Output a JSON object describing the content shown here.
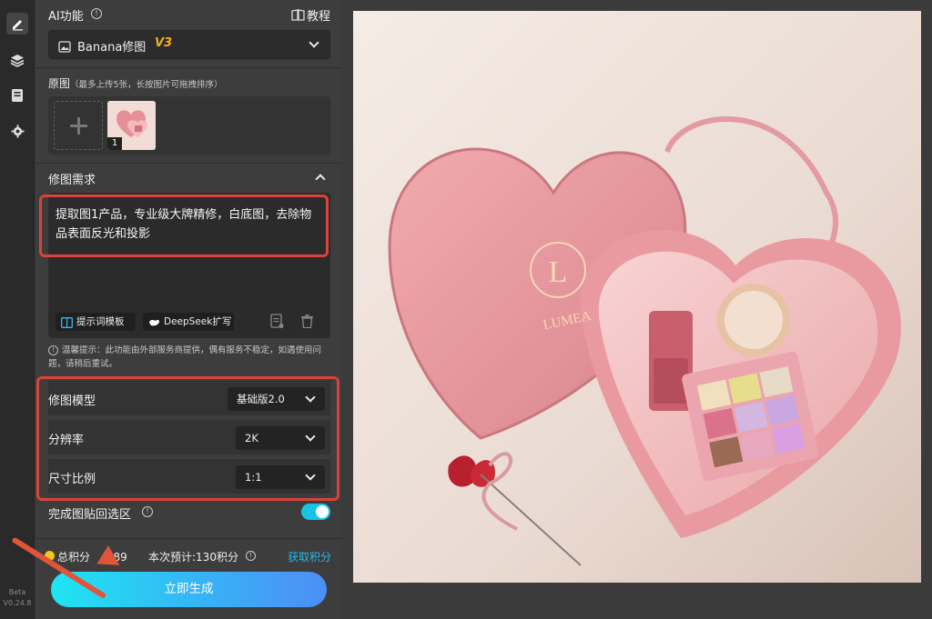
{
  "app": {
    "version_tag": "Beta",
    "version": "V0.24.8"
  },
  "rail": {
    "items": [
      {
        "icon": "pencil-icon",
        "active": true
      },
      {
        "icon": "layers-icon",
        "active": false
      },
      {
        "icon": "notebook-icon",
        "active": false
      },
      {
        "icon": "gear-icon",
        "active": false
      }
    ]
  },
  "ai_feature": {
    "label": "AI功能",
    "tutorial_label": "教程",
    "model_name": "Banana修图",
    "model_version": "V3"
  },
  "source": {
    "label": "原图",
    "hint": "（最多上传5张，长按图片可拖拽排序）",
    "thumbnails": [
      {
        "index": "1"
      }
    ]
  },
  "request": {
    "label": "修图需求",
    "prompt": "提取图1产品，专业级大牌精修，白底图，去除物品表面反光和投影",
    "template_button": "提示词模板",
    "deepseek_button": "DeepSeek扩写"
  },
  "notice": "温馨提示：此功能由外部服务商提供，偶有服务不稳定，如遇使用问题，请稍后重试。",
  "settings": [
    {
      "label": "修图模型",
      "value": "基础版2.0"
    },
    {
      "label": "分辨率",
      "value": "2K"
    },
    {
      "label": "尺寸比例",
      "value": "1:1"
    }
  ],
  "paste_back": {
    "label": "完成图贴回选区",
    "enabled": true
  },
  "credits": {
    "total_label": "总积分",
    "total_value": "289",
    "estimate": "本次预计:130积分",
    "get_link": "获取积分"
  },
  "generate_button": "立即生成",
  "preview": {
    "brand_text": "LUMEA",
    "monogram": "L"
  },
  "colors": {
    "accent": "#19c3e6",
    "highlight": "#d9433b",
    "link": "#29b6e8",
    "credit_coin": "#f5c518"
  }
}
